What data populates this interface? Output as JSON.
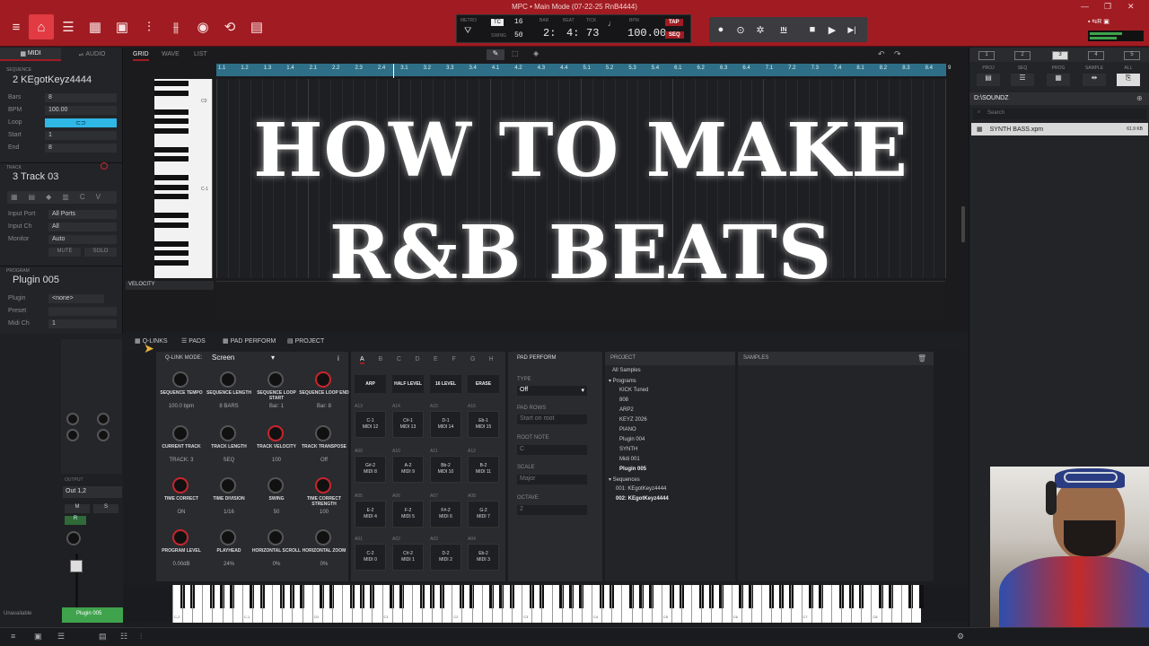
{
  "app": {
    "title": "MPC • Main Mode (07-22-25 RnB4444)"
  },
  "toolbar": {
    "icons": [
      "menu-icon",
      "home-icon",
      "list-icon",
      "grid-icon",
      "step-seq-icon",
      "mixer-icon",
      "record-icon",
      "loop-icon",
      "pad-icon",
      "sample-icon"
    ]
  },
  "seq": {
    "metro_label": "METRO",
    "tc": "TC",
    "tc_value": "16",
    "swing_label": "SWING",
    "swing_value": "50",
    "bar_label": "BAR",
    "bar": "2:",
    "beat_label": "BEAT",
    "beat": "4:",
    "tick_label": "TICK",
    "tick": "73",
    "bpm_label": "BPM",
    "bpm": "100.00",
    "tap": "TAP",
    "seq": "SEQ"
  },
  "transport": {
    "rec": "●",
    "overdub": "⊙",
    "auto": "✲",
    "in": "IN",
    "stop": "■",
    "play": "▶",
    "playstart": "▶|"
  },
  "left": {
    "tab_midi": "MIDI",
    "tab_audio": "AUDIO",
    "sequence_label": "SEQUENCE",
    "sequence_name": "2 KEgotKeyz4444",
    "bars_label": "Bars",
    "bars": "8",
    "bpm_label": "BPM",
    "bpm": "100.00",
    "loop_label": "Loop",
    "start_label": "Start",
    "start": "1",
    "end_label": "End",
    "end": "8",
    "track_label": "TRACK",
    "track_name": "3 Track 03",
    "input_port_label": "Input Port",
    "input_port": "All Ports",
    "input_ch_label": "Input Ch",
    "input_ch": "All",
    "monitor_label": "Monitor",
    "monitor": "Auto",
    "mute": "MUTE",
    "solo": "SOLO",
    "program_label": "PROGRAM",
    "program_name": "Plugin 005",
    "plugin_label": "Plugin",
    "plugin": "<none>",
    "preset_label": "Preset",
    "preset": "",
    "midich_label": "Midi Ch",
    "midich": "1",
    "output_label": "OUTPUT",
    "output": "Out 1,2",
    "m": "M",
    "s": "S",
    "r": "R",
    "unavailable": "Unavailable",
    "plugin_channel": "Plugin 005"
  },
  "editor": {
    "tabs": [
      "GRID",
      "WAVE",
      "LIST"
    ],
    "velocity": "VELOCITY",
    "ruler": [
      "1.1",
      "1.2",
      "1.3",
      "1.4",
      "2.1",
      "2.2",
      "2.3",
      "2.4",
      "3.1",
      "3.2",
      "3.3",
      "3.4",
      "4.1",
      "4.2",
      "4.3",
      "4.4",
      "5.1",
      "5.2",
      "5.3",
      "5.4",
      "6.1",
      "6.2",
      "6.3",
      "6.4",
      "7.1",
      "7.2",
      "7.3",
      "7.4",
      "8.1",
      "8.2",
      "8.3",
      "8.4",
      "9"
    ],
    "c0": "C0",
    "cm1": "C-1"
  },
  "headline": {
    "line1": "HOW TO MAKE",
    "line2": "R&B BEATS"
  },
  "subtabs": {
    "qlinks": "Q-LINKS",
    "pads": "PADS",
    "padperform": "PAD PERFORM",
    "project": "PROJECT"
  },
  "qlink": {
    "mode_label": "Q-LINK MODE:",
    "mode": "Screen",
    "knobs": [
      {
        "label": "SEQUENCE TEMPO",
        "value": "100.0 bpm"
      },
      {
        "label": "SEQUENCE LENGTH",
        "value": "8 BARS"
      },
      {
        "label": "SEQUENCE LOOP START",
        "value": "Bar: 1"
      },
      {
        "label": "SEQUENCE LOOP END",
        "value": "Bar: 8"
      },
      {
        "label": "CURRENT TRACK",
        "value": "TRACK: 3"
      },
      {
        "label": "TRACK LENGTH",
        "value": "SEQ"
      },
      {
        "label": "TRACK VELOCITY",
        "value": "100"
      },
      {
        "label": "TRACK TRANSPOSE",
        "value": "Off"
      },
      {
        "label": "TIME CORRECT",
        "value": "ON"
      },
      {
        "label": "TIME DIVISION",
        "value": "1/16"
      },
      {
        "label": "SWING",
        "value": "50"
      },
      {
        "label": "TIME CORRECT STRENGTH",
        "value": "100"
      },
      {
        "label": "PROGRAM LEVEL",
        "value": "0.00dB"
      },
      {
        "label": "PLAYHEAD",
        "value": "24%"
      },
      {
        "label": "HORIZONTAL SCROLL",
        "value": "0%"
      },
      {
        "label": "HORIZONTAL ZOOM",
        "value": "0%"
      }
    ]
  },
  "pads": {
    "banks": [
      "A",
      "B",
      "C",
      "D",
      "E",
      "F",
      "G",
      "H"
    ],
    "buttons": [
      "ARP",
      "HALF LEVEL",
      "16 LEVEL",
      "ERASE"
    ],
    "grid": [
      [
        {
          "n": "A13",
          "l1": "C-1",
          "l2": "MIDI 12"
        },
        {
          "n": "A14",
          "l1": "C#-1",
          "l2": "MIDI 13"
        },
        {
          "n": "A15",
          "l1": "D-1",
          "l2": "MIDI 14"
        },
        {
          "n": "A16",
          "l1": "Eb-1",
          "l2": "MIDI 15"
        }
      ],
      [
        {
          "n": "A09",
          "l1": "G#-2",
          "l2": "MIDI 8"
        },
        {
          "n": "A10",
          "l1": "A-2",
          "l2": "MIDI 9"
        },
        {
          "n": "A11",
          "l1": "Bb-2",
          "l2": "MIDI 10"
        },
        {
          "n": "A12",
          "l1": "B-2",
          "l2": "MIDI 11"
        }
      ],
      [
        {
          "n": "A05",
          "l1": "E-2",
          "l2": "MIDI 4"
        },
        {
          "n": "A06",
          "l1": "F-2",
          "l2": "MIDI 5"
        },
        {
          "n": "A07",
          "l1": "F#-2",
          "l2": "MIDI 6"
        },
        {
          "n": "A08",
          "l1": "G-2",
          "l2": "MIDI 7"
        }
      ],
      [
        {
          "n": "A01",
          "l1": "C-2",
          "l2": "MIDI 0"
        },
        {
          "n": "A02",
          "l1": "C#-2",
          "l2": "MIDI 1"
        },
        {
          "n": "A03",
          "l1": "D-2",
          "l2": "MIDI 2"
        },
        {
          "n": "A04",
          "l1": "Eb-2",
          "l2": "MIDI 3"
        }
      ]
    ]
  },
  "padperform": {
    "title": "PAD PERFORM",
    "type_label": "TYPE",
    "type": "Off",
    "rows_label": "PAD ROWS",
    "rows": "Start on root",
    "root_label": "ROOT NOTE",
    "root": "C",
    "scale_label": "SCALE",
    "scale": "Major",
    "octave_label": "OCTAVE",
    "octave": "2"
  },
  "project": {
    "title": "PROJECT",
    "items": [
      "All Samples",
      "▾ Programs",
      "KICK Tuned",
      "808",
      "ARP2",
      "KEYZ 2026",
      "PIANO",
      "Plugin 004",
      "SYNTH",
      "Midi 001",
      "Plugin 005",
      "▾ Sequences",
      "001: KEgotKeyz4444",
      "002: KEgotKeyz4444"
    ]
  },
  "samples": {
    "title": "SAMPLES"
  },
  "keyboard": {
    "labels": [
      "C-2",
      "C-1",
      "C0",
      "C1",
      "C2",
      "C3",
      "C4",
      "C5",
      "C6",
      "C7",
      "C8"
    ]
  },
  "right": {
    "tabs": [
      "1",
      "2",
      "3",
      "4",
      "5"
    ],
    "cats": [
      "PROJ",
      "SEQ",
      "PROG",
      "SAMPLE",
      "ALL"
    ],
    "path": "D:\\SOUNDZ",
    "search": "Search",
    "file": "SYNTH BASS.xpm",
    "size": "61.9 KB"
  },
  "colors": {
    "accent": "#a01c22",
    "loop": "#2fb7e6",
    "ruler": "#2e6f87",
    "green": "#3fa34d"
  }
}
